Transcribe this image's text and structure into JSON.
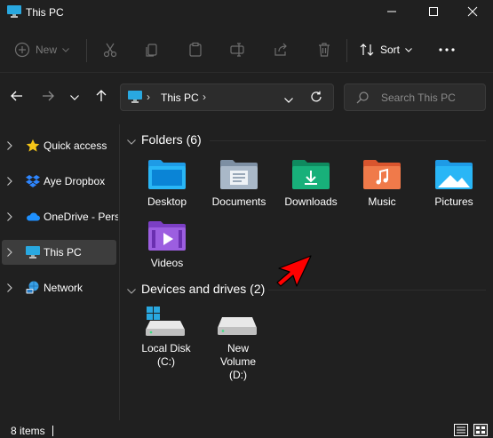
{
  "window": {
    "title": "This PC",
    "controls": [
      "minimize-icon",
      "maximize-icon",
      "close-icon"
    ]
  },
  "toolbar": {
    "new_label": "New",
    "sort_label": "Sort",
    "icons": [
      "cut-icon",
      "copy-icon",
      "paste-icon",
      "rename-icon",
      "share-icon",
      "delete-icon",
      "more-icon"
    ]
  },
  "address": {
    "location": "This PC",
    "separator": "›"
  },
  "search": {
    "placeholder": "Search This PC"
  },
  "sidebar": {
    "items": [
      {
        "label": "Quick access",
        "icon": "star-icon"
      },
      {
        "label": "Aye Dropbox",
        "icon": "dropbox-icon"
      },
      {
        "label": "OneDrive - Pers",
        "icon": "cloud-icon"
      },
      {
        "label": "This PC",
        "icon": "monitor-icon",
        "selected": true
      },
      {
        "label": "Network",
        "icon": "network-icon"
      }
    ]
  },
  "main": {
    "folders": {
      "header": "Folders (6)",
      "items": [
        {
          "label": "Desktop",
          "icon": "desktop-folder-icon"
        },
        {
          "label": "Documents",
          "icon": "documents-folder-icon"
        },
        {
          "label": "Downloads",
          "icon": "downloads-folder-icon"
        },
        {
          "label": "Music",
          "icon": "music-folder-icon"
        },
        {
          "label": "Pictures",
          "icon": "pictures-folder-icon"
        },
        {
          "label": "Videos",
          "icon": "videos-folder-icon"
        }
      ]
    },
    "drives": {
      "header": "Devices and drives (2)",
      "items": [
        {
          "label_line1": "Local Disk",
          "label_line2": "(C:)",
          "icon": "system-drive-icon"
        },
        {
          "label_line1": "New",
          "label_line2": "Volume",
          "label_line3": "(D:)",
          "icon": "drive-icon"
        }
      ]
    }
  },
  "statusbar": {
    "count": "8 items"
  },
  "colors": {
    "background": "#202020",
    "selected": "#3d3d3d",
    "accent": "#0a84d6",
    "arrow": "#ff0000"
  }
}
